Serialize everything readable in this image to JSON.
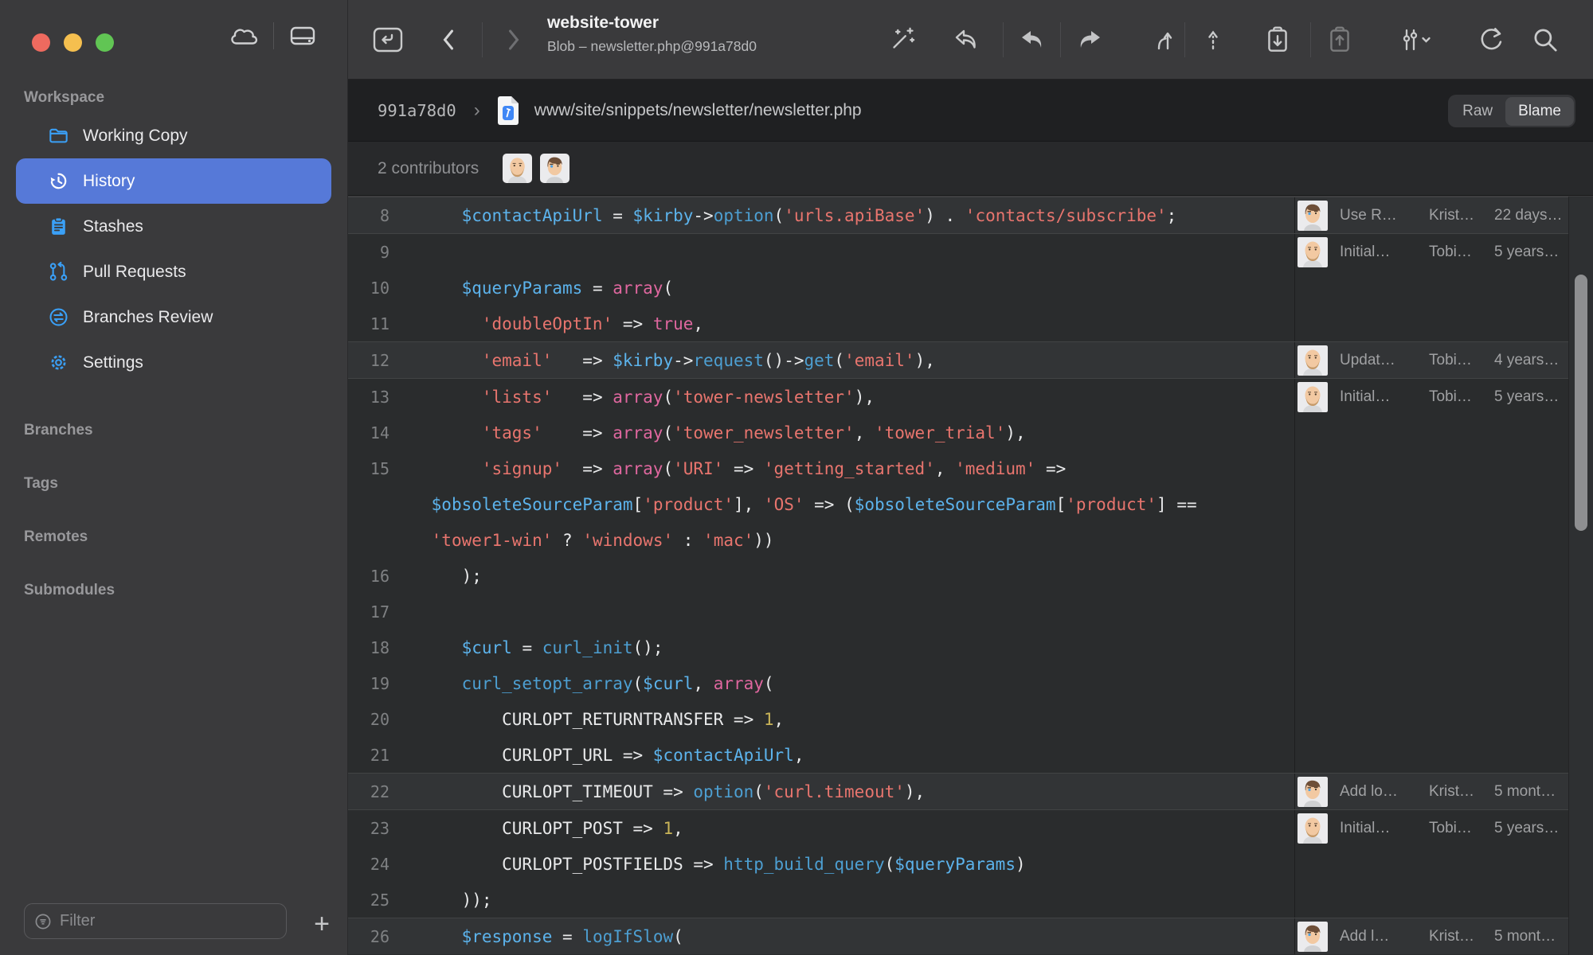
{
  "toolbar": {
    "title": "website-tower",
    "subtitle": "Blob – newsletter.php@991a78d0"
  },
  "breadcrumb": {
    "commit": "991a78d0",
    "separator": "›",
    "path": "www/site/snippets/newsletter/newsletter.php",
    "raw_label": "Raw",
    "blame_label": "Blame",
    "active_view": "Blame"
  },
  "contributors": {
    "label": "2 contributors",
    "avatars": [
      "tobias",
      "kristian"
    ]
  },
  "sidebar": {
    "workspace_label": "Workspace",
    "items": [
      {
        "label": "Working Copy",
        "icon": "folder-icon",
        "selected": false
      },
      {
        "label": "History",
        "icon": "history-icon",
        "selected": true
      },
      {
        "label": "Stashes",
        "icon": "stash-icon",
        "selected": false
      },
      {
        "label": "Pull Requests",
        "icon": "pull-request-icon",
        "selected": false
      },
      {
        "label": "Branches Review",
        "icon": "branches-review-icon",
        "selected": false
      },
      {
        "label": "Settings",
        "icon": "gear-icon",
        "selected": false
      }
    ],
    "sections": [
      "Branches",
      "Tags",
      "Remotes",
      "Submodules"
    ],
    "filter_placeholder": "Filter",
    "add_button_label": "+"
  },
  "code": {
    "hunks": [
      {
        "alt": true,
        "blame": {
          "avatar": "kristian",
          "message": "Use R…",
          "author": "Krist…",
          "date": "22 days…"
        },
        "rows": [
          {
            "ln": "8",
            "t": [
              [
                "p",
                "    "
              ],
              [
                "v",
                "$contactApiUrl"
              ],
              [
                "p",
                " = "
              ],
              [
                "v",
                "$kirby"
              ],
              [
                "p",
                "->"
              ],
              [
                "f",
                "option"
              ],
              [
                "p",
                "("
              ],
              [
                "s",
                "'urls.apiBase'"
              ],
              [
                "p",
                ") . "
              ],
              [
                "s",
                "'contacts/subscribe'"
              ],
              [
                "p",
                ";"
              ]
            ]
          }
        ]
      },
      {
        "alt": false,
        "blame": {
          "avatar": "tobias",
          "message": "Initial…",
          "author": "Tobi…",
          "date": "5 years…"
        },
        "rows": [
          {
            "ln": "9",
            "t": []
          },
          {
            "ln": "10",
            "t": [
              [
                "p",
                "    "
              ],
              [
                "v",
                "$queryParams"
              ],
              [
                "p",
                " = "
              ],
              [
                "k",
                "array"
              ],
              [
                "p",
                "("
              ]
            ]
          },
          {
            "ln": "11",
            "t": [
              [
                "p",
                "      "
              ],
              [
                "s",
                "'doubleOptIn'"
              ],
              [
                "p",
                " => "
              ],
              [
                "k",
                "true"
              ],
              [
                "p",
                ","
              ]
            ]
          }
        ]
      },
      {
        "alt": true,
        "blame": {
          "avatar": "tobias",
          "message": "Updat…",
          "author": "Tobi…",
          "date": "4 years…"
        },
        "rows": [
          {
            "ln": "12",
            "t": [
              [
                "p",
                "      "
              ],
              [
                "s",
                "'email'"
              ],
              [
                "p",
                "   => "
              ],
              [
                "v",
                "$kirby"
              ],
              [
                "p",
                "->"
              ],
              [
                "f",
                "request"
              ],
              [
                "p",
                "()->"
              ],
              [
                "f",
                "get"
              ],
              [
                "p",
                "("
              ],
              [
                "s",
                "'email'"
              ],
              [
                "p",
                "),"
              ]
            ]
          }
        ]
      },
      {
        "alt": false,
        "blame": {
          "avatar": "tobias",
          "message": "Initial…",
          "author": "Tobi…",
          "date": "5 years…"
        },
        "rows": [
          {
            "ln": "13",
            "t": [
              [
                "p",
                "      "
              ],
              [
                "s",
                "'lists'"
              ],
              [
                "p",
                "   => "
              ],
              [
                "k",
                "array"
              ],
              [
                "p",
                "("
              ],
              [
                "s",
                "'tower-newsletter'"
              ],
              [
                "p",
                "),"
              ]
            ]
          },
          {
            "ln": "14",
            "t": [
              [
                "p",
                "      "
              ],
              [
                "s",
                "'tags'"
              ],
              [
                "p",
                "    => "
              ],
              [
                "k",
                "array"
              ],
              [
                "p",
                "("
              ],
              [
                "s",
                "'tower_newsletter'"
              ],
              [
                "p",
                ", "
              ],
              [
                "s",
                "'tower_trial'"
              ],
              [
                "p",
                "),"
              ]
            ]
          },
          {
            "ln": "15",
            "t": [
              [
                "p",
                "      "
              ],
              [
                "s",
                "'signup'"
              ],
              [
                "p",
                "  => "
              ],
              [
                "k",
                "array"
              ],
              [
                "p",
                "("
              ],
              [
                "s",
                "'URI'"
              ],
              [
                "p",
                " => "
              ],
              [
                "s",
                "'getting_started'"
              ],
              [
                "p",
                ", "
              ],
              [
                "s",
                "'medium'"
              ],
              [
                "p",
                " =>"
              ]
            ]
          },
          {
            "ln": "",
            "t": [
              [
                "p",
                " "
              ],
              [
                "v",
                "$obsoleteSourceParam"
              ],
              [
                "p",
                "["
              ],
              [
                "s",
                "'product'"
              ],
              [
                "p",
                "], "
              ],
              [
                "s",
                "'OS'"
              ],
              [
                "p",
                " => ("
              ],
              [
                "v",
                "$obsoleteSourceParam"
              ],
              [
                "p",
                "["
              ],
              [
                "s",
                "'product'"
              ],
              [
                "p",
                "] =="
              ]
            ]
          },
          {
            "ln": "",
            "t": [
              [
                "p",
                " "
              ],
              [
                "s",
                "'tower1-win'"
              ],
              [
                "p",
                " ? "
              ],
              [
                "s",
                "'windows'"
              ],
              [
                "p",
                " : "
              ],
              [
                "s",
                "'mac'"
              ],
              [
                "p",
                "))"
              ]
            ]
          },
          {
            "ln": "16",
            "t": [
              [
                "p",
                "    );"
              ]
            ]
          },
          {
            "ln": "17",
            "t": []
          },
          {
            "ln": "18",
            "t": [
              [
                "p",
                "    "
              ],
              [
                "v",
                "$curl"
              ],
              [
                "p",
                " = "
              ],
              [
                "f",
                "curl_init"
              ],
              [
                "p",
                "();"
              ]
            ]
          },
          {
            "ln": "19",
            "t": [
              [
                "p",
                "    "
              ],
              [
                "f",
                "curl_setopt_array"
              ],
              [
                "p",
                "("
              ],
              [
                "v",
                "$curl"
              ],
              [
                "p",
                ", "
              ],
              [
                "k",
                "array"
              ],
              [
                "p",
                "("
              ]
            ]
          },
          {
            "ln": "20",
            "t": [
              [
                "p",
                "        CURLOPT_RETURNTRANSFER => "
              ],
              [
                "n",
                "1"
              ],
              [
                "p",
                ","
              ]
            ]
          },
          {
            "ln": "21",
            "t": [
              [
                "p",
                "        CURLOPT_URL => "
              ],
              [
                "v",
                "$contactApiUrl"
              ],
              [
                "p",
                ","
              ]
            ]
          }
        ]
      },
      {
        "alt": true,
        "blame": {
          "avatar": "kristian",
          "message": "Add lo…",
          "author": "Krist…",
          "date": "5 mont…"
        },
        "rows": [
          {
            "ln": "22",
            "t": [
              [
                "p",
                "        CURLOPT_TIMEOUT => "
              ],
              [
                "f",
                "option"
              ],
              [
                "p",
                "("
              ],
              [
                "s",
                "'curl.timeout'"
              ],
              [
                "p",
                "),"
              ]
            ]
          }
        ]
      },
      {
        "alt": false,
        "blame": {
          "avatar": "tobias",
          "message": "Initial…",
          "author": "Tobi…",
          "date": "5 years…"
        },
        "rows": [
          {
            "ln": "23",
            "t": [
              [
                "p",
                "        CURLOPT_POST => "
              ],
              [
                "n",
                "1"
              ],
              [
                "p",
                ","
              ]
            ]
          },
          {
            "ln": "24",
            "t": [
              [
                "p",
                "        CURLOPT_POSTFIELDS => "
              ],
              [
                "f",
                "http_build_query"
              ],
              [
                "p",
                "("
              ],
              [
                "v",
                "$queryParams"
              ],
              [
                "p",
                ")"
              ]
            ]
          },
          {
            "ln": "25",
            "t": [
              [
                "p",
                "    ));"
              ]
            ]
          }
        ]
      },
      {
        "alt": true,
        "blame": {
          "avatar": "kristian",
          "message": "Add l…",
          "author": "Krist…",
          "date": "5 mont…"
        },
        "rows": [
          {
            "ln": "26",
            "t": [
              [
                "p",
                "    "
              ],
              [
                "v",
                "$response"
              ],
              [
                "p",
                " = "
              ],
              [
                "f",
                "logIfSlow"
              ],
              [
                "p",
                "("
              ]
            ]
          }
        ]
      }
    ]
  },
  "colors": {
    "accent_blue": "#3aa0f7",
    "selection_blue": "#5679d8",
    "traffic_red": "#ee6a5f",
    "traffic_yellow": "#f5bf4f",
    "traffic_green": "#61c554",
    "code_bg": "#2a2c2d",
    "code_bg_alt": "#323436",
    "code_string": "#e8756e",
    "code_variable": "#5cb3ec",
    "code_function": "#4d9fd2",
    "code_keyword": "#df679f",
    "code_number": "#c9b458"
  }
}
